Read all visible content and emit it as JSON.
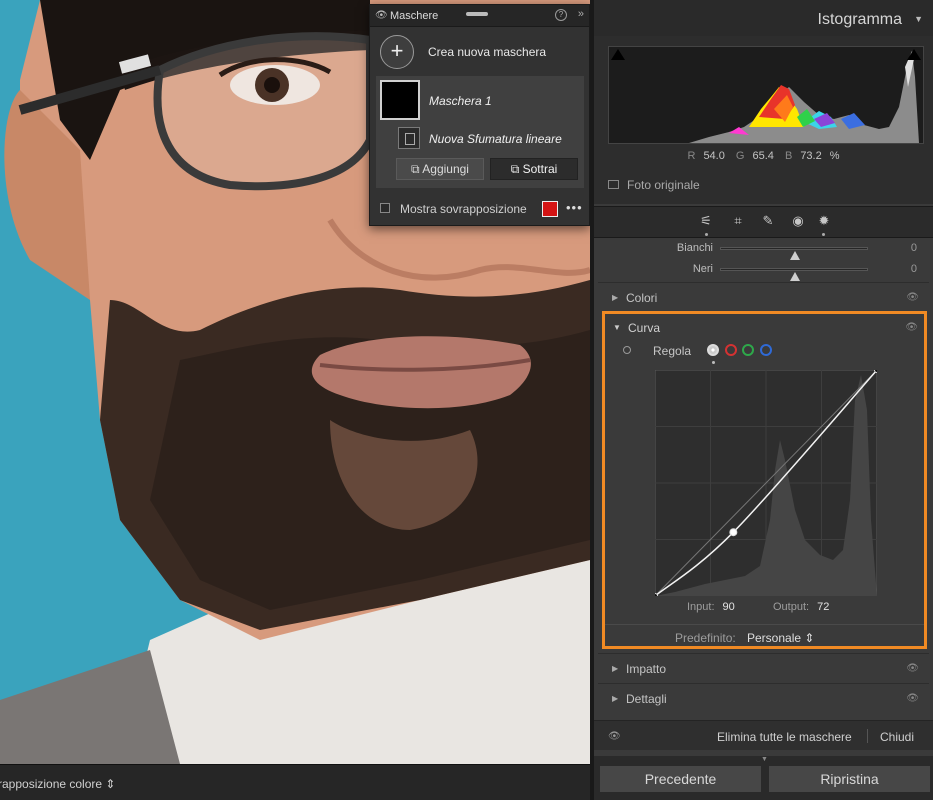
{
  "photo": {
    "bottom_label": "rapposizione colore ⇕"
  },
  "masks_panel": {
    "title": "Maschere",
    "help_icon": "?",
    "more_icon": "»",
    "create_label": "Crea nuova maschera",
    "mask_name": "Maschera 1",
    "component_name": "Nuova Sfumatura lineare",
    "add_label": "Aggiungi",
    "subtract_label": "Sottrai",
    "show_overlay_label": "Mostra sovrapposizione",
    "overlay_color": "#d41414",
    "more_dots": "•••"
  },
  "histogram": {
    "title": "Istogramma",
    "r_label": "R",
    "r_value": "54.0",
    "g_label": "G",
    "g_value": "65.4",
    "b_label": "B",
    "b_value": "73.2",
    "percent": "%",
    "original_photo_label": "Foto originale"
  },
  "tools": [
    "sliders-icon",
    "crop-icon",
    "heal-icon",
    "redeye-icon",
    "masking-icon"
  ],
  "sliders": [
    {
      "label": "Bianchi",
      "value": "0",
      "fraction": 0.5
    },
    {
      "label": "Neri",
      "value": "0",
      "fraction": 0.5
    }
  ],
  "sections": {
    "colors": "Colori",
    "curve": "Curva",
    "impact": "Impatto",
    "details": "Dettagli"
  },
  "curve": {
    "regola_label": "Regola",
    "input_label": "Input:",
    "input_value": "90",
    "output_label": "Output:",
    "output_value": "72",
    "preset_label": "Predefinito:",
    "preset_value": "Personale ⇕",
    "points": [
      [
        0,
        0
      ],
      [
        90,
        72
      ],
      [
        255,
        255
      ]
    ]
  },
  "footer": {
    "delete_all_label": "Elimina tutte le maschere",
    "close_label": "Chiudi",
    "previous_label": "Precedente",
    "reset_label": "Ripristina"
  },
  "colors": {
    "accent": "#f08a24"
  }
}
